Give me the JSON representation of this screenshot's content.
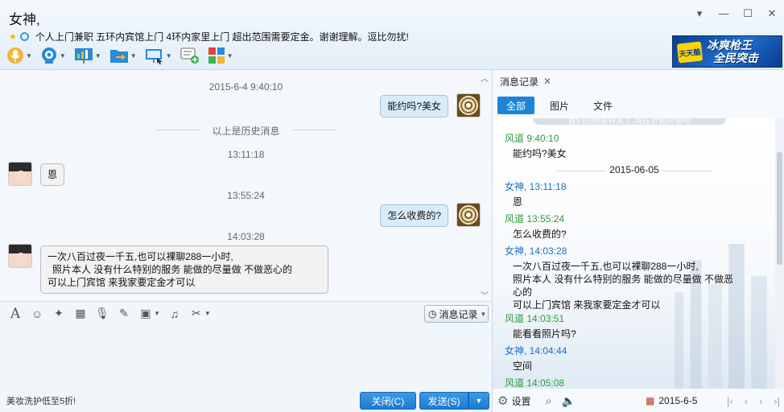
{
  "window": {
    "contact_name": "女神,",
    "signature": "个人上门兼职 五环内宾馆上门 4环内家里上门 超出范围需要定金。谢谢理解。逗比勿扰!",
    "controls": [
      "▾",
      "—",
      "☐",
      "✕"
    ]
  },
  "toolbar": {
    "items": [
      "voice-call",
      "video-call",
      "screen-share",
      "send-file",
      "remote-desktop",
      "create-group",
      "apps"
    ]
  },
  "ad": {
    "badge": "天天酷",
    "line1": "冰爽枪王",
    "line2": "全民突击"
  },
  "chat": {
    "timestamp_top": "2015-6-4 9:40:10",
    "msg1": "能约吗?美女",
    "history_divider": "以上是历史消息",
    "time2": "13:11:18",
    "msg2": "恩",
    "time3": "13:55:24",
    "msg3": "怎么收费的?",
    "time4": "14:03:28",
    "msg4_line1": "一次八百过夜一千五,也可以裸聊288一小时,",
    "msg4_line2": "照片本人 没有什么特别的服务 能做的尽量做 不做恶心的",
    "msg4_line3": "可以上门宾馆 来我家要定金才可以"
  },
  "input_toolbar": {
    "history_button": "消息记录"
  },
  "bottom": {
    "promo": "美妆洗护低至5折!",
    "close_button": "关闭(C)",
    "send_button": "发送(S)"
  },
  "side": {
    "tab_title": "消息记录",
    "filters": [
      "全部",
      "图片",
      "文件"
    ],
    "faded_top": "我们已经是好友了,现在开始对话吧",
    "records": [
      {
        "type": "name",
        "who": "me",
        "text": "风道 9:40:10"
      },
      {
        "type": "msg",
        "text": "能约吗?美女"
      },
      {
        "type": "date",
        "text": "2015-06-05"
      },
      {
        "type": "name",
        "who": "her",
        "text": "女神, 13:11:18"
      },
      {
        "type": "msg",
        "text": "恩"
      },
      {
        "type": "name",
        "who": "me",
        "text": "风道 13:55:24"
      },
      {
        "type": "msg",
        "text": "怎么收费的?"
      },
      {
        "type": "name",
        "who": "her",
        "text": "女神, 14:03:28"
      },
      {
        "type": "msg",
        "text": "一次八百过夜一千五,也可以裸聊288一小时,"
      },
      {
        "type": "msg2",
        "text": " 照片本人 没有什么特别的服务 能做的尽量做 不做恶"
      },
      {
        "type": "msg2",
        "text": "心的"
      },
      {
        "type": "msg2",
        "text": "可以上门宾馆 来我家要定金才可以"
      },
      {
        "type": "name",
        "who": "me",
        "text": "风道 14:03:51"
      },
      {
        "type": "msg",
        "text": "能看看照片吗?"
      },
      {
        "type": "name",
        "who": "her",
        "text": "女神, 14:04:44"
      },
      {
        "type": "msg",
        "text": "空间"
      },
      {
        "type": "name",
        "who": "me",
        "text": "风道 14:05:08"
      }
    ],
    "settings_label": "设置",
    "date_value": "2015-6-5"
  }
}
